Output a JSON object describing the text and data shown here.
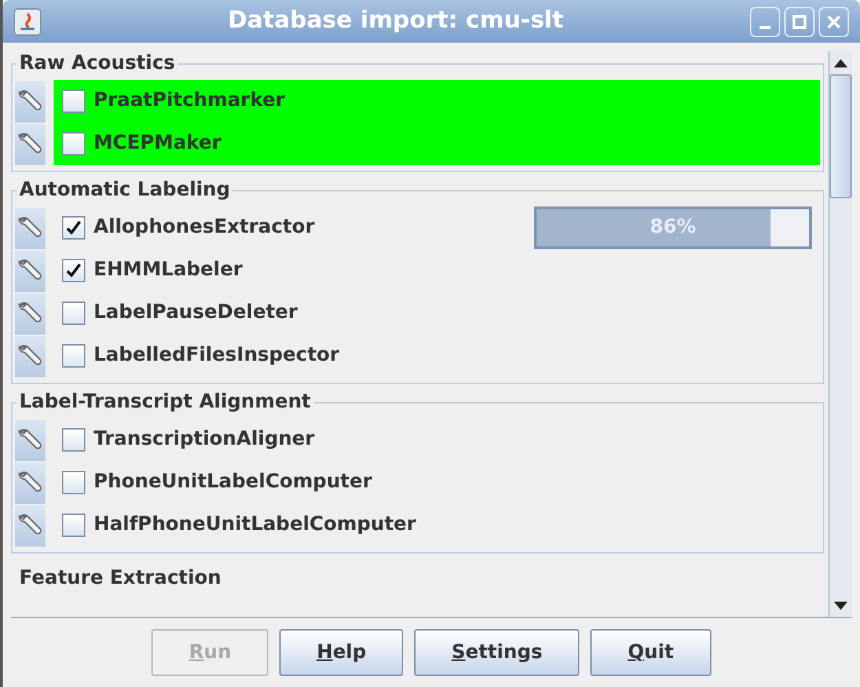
{
  "window": {
    "title": "Database import: cmu-slt"
  },
  "sections": [
    {
      "title": "Raw Acoustics",
      "items": [
        {
          "name": "PraatPitchmarker",
          "checked": false,
          "highlighted": true
        },
        {
          "name": "MCEPMaker",
          "checked": false,
          "highlighted": true
        }
      ]
    },
    {
      "title": "Automatic Labeling",
      "items": [
        {
          "name": "AllophonesExtractor",
          "checked": true,
          "highlighted": false,
          "progress": {
            "level": 0.86,
            "reading": "86%"
          }
        },
        {
          "name": "EHMMLabeler",
          "checked": true,
          "highlighted": false
        },
        {
          "name": "LabelPauseDeleter",
          "checked": false,
          "highlighted": false
        },
        {
          "name": "LabelledFilesInspector",
          "checked": false,
          "highlighted": false
        }
      ]
    },
    {
      "title": "Label-Transcript Alignment",
      "items": [
        {
          "name": "TranscriptionAligner",
          "checked": false,
          "highlighted": false
        },
        {
          "name": "PhoneUnitLabelComputer",
          "checked": false,
          "highlighted": false
        },
        {
          "name": "HalfPhoneUnitLabelComputer",
          "checked": false,
          "highlighted": false
        }
      ]
    },
    {
      "title": "Feature Extraction"
    }
  ],
  "buttons": [
    {
      "label": "Run",
      "disabled": true
    },
    {
      "label": "Help",
      "disabled": false
    },
    {
      "label": "Settings",
      "disabled": false
    },
    {
      "label": "Quit",
      "disabled": false
    }
  ]
}
